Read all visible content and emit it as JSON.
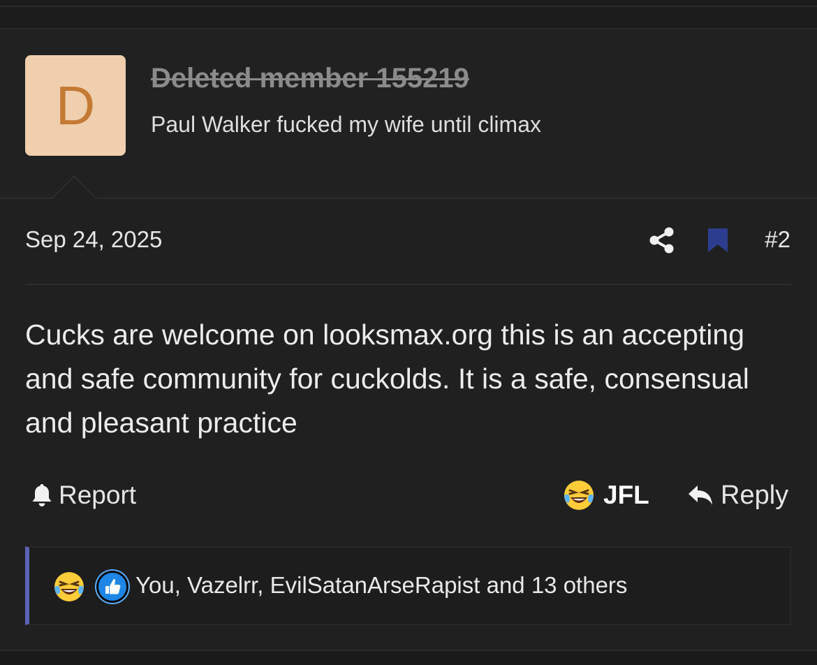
{
  "user": {
    "avatar_letter": "D",
    "avatar_bg": "#efcfae",
    "avatar_fg": "#c47a34",
    "name": "Deleted member 155219",
    "title": "Paul Walker fucked my wife until climax"
  },
  "post": {
    "date": "Sep 24, 2025",
    "number": "#2",
    "body": "Cucks are welcome on looksmax.org this is an accepting and safe community for cuckolds. It is a safe, consensual and pleasant practice",
    "bookmark_color": "#2c3d8f"
  },
  "actions": {
    "report_label": "Report",
    "reaction_label": "JFL",
    "reply_label": "Reply"
  },
  "reactions": {
    "summary": "You, Vazelrr, EvilSatanArseRapist and 13 others",
    "accent": "#5a63b5",
    "icons": [
      "laughing-crying-emoji-icon",
      "thumbs-up-icon"
    ]
  }
}
